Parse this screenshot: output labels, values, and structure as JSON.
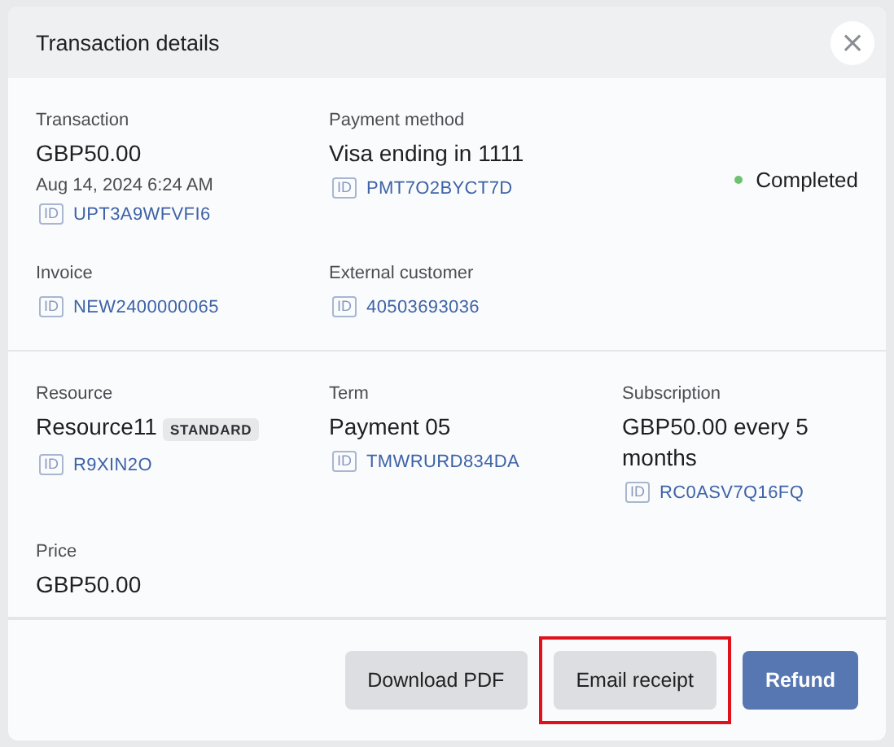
{
  "dialog": {
    "title": "Transaction details",
    "close_icon": "×"
  },
  "sections": [
    {
      "rows": [
        [
          {
            "kind": "field",
            "label": "Transaction",
            "value": "GBP50.00",
            "date": "Aug 14, 2024 6:24 AM",
            "id": {
              "tag": "ID",
              "code": "UPT3A9WFVFI6"
            }
          },
          {
            "kind": "field",
            "label": "Payment method",
            "value": "Visa ending in 1111",
            "id": {
              "tag": "ID",
              "code": "PMT7O2BYCT7D"
            }
          },
          {
            "kind": "status",
            "label": "Completed",
            "color": "#6cc26f"
          }
        ],
        [
          {
            "kind": "field",
            "label": "Invoice",
            "id": {
              "tag": "ID",
              "code": "NEW2400000065"
            }
          },
          {
            "kind": "field",
            "label": "External customer",
            "id": {
              "tag": "ID",
              "code": "40503693036"
            }
          }
        ]
      ]
    },
    {
      "rows": [
        [
          {
            "kind": "field",
            "label": "Resource",
            "value": "Resource11",
            "tag": "STANDARD",
            "id": {
              "tag": "ID",
              "code": "R9XIN2O"
            }
          },
          {
            "kind": "field",
            "label": "Term",
            "value": "Payment 05",
            "id": {
              "tag": "ID",
              "code": "TMWRURD834DA"
            }
          },
          {
            "kind": "field",
            "label": "Subscription",
            "value": "GBP50.00 every 5 months",
            "id": {
              "tag": "ID",
              "code": "RC0ASV7Q16FQ"
            }
          }
        ],
        [
          {
            "kind": "field",
            "label": "Price",
            "value": "GBP50.00"
          }
        ]
      ]
    }
  ],
  "buttons": [
    {
      "label": "Download PDF",
      "kind": "secondary",
      "highlighted": false
    },
    {
      "label": "Email receipt",
      "kind": "secondary",
      "highlighted": true
    },
    {
      "label": "Refund",
      "kind": "primary",
      "highlighted": false
    }
  ]
}
